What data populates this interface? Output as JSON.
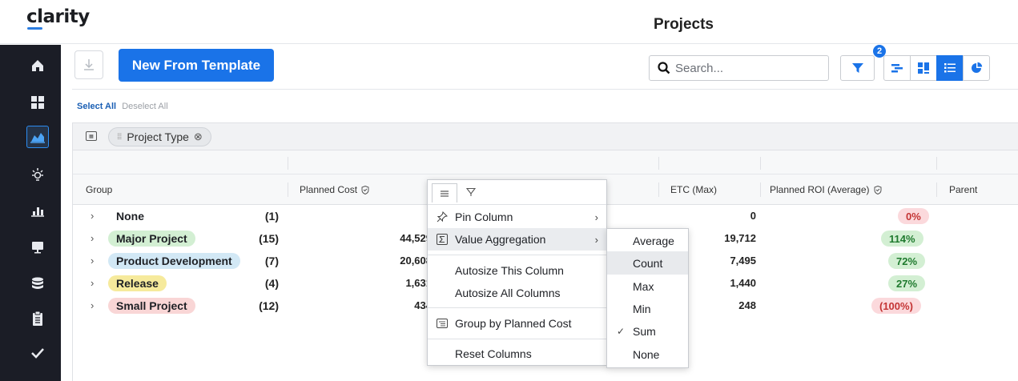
{
  "app": {
    "logo": "clarity",
    "page_title": "Projects"
  },
  "toolbar": {
    "new_template_label": "New From Template",
    "search_placeholder": "Search...",
    "filter_count": "2"
  },
  "selection": {
    "select_all": "Select All",
    "deselect_all": "Deselect All"
  },
  "grouping": {
    "chip_label": "Project Type",
    "remove_symbol": "⊗"
  },
  "columns": {
    "group": "Group",
    "planned_cost": "Planned Cost",
    "etc": "ETC (Max)",
    "planned_roi": "Planned ROI (Average)",
    "parent": "Parent"
  },
  "rows": [
    {
      "label": "None",
      "count": "(1)",
      "cost": "",
      "etc": "0",
      "roi": "0%",
      "tag_color": "",
      "roi_color": "#fbd9dc"
    },
    {
      "label": "Major Project",
      "count": "(15)",
      "cost": "44,529",
      "etc": "19,712",
      "roi": "114%",
      "tag_color": "#d3efd3",
      "roi_color": "#d3efd3"
    },
    {
      "label": "Product Development",
      "count": "(7)",
      "cost": "20,608",
      "etc": "7,495",
      "roi": "72%",
      "tag_color": "#d2e8f5",
      "roi_color": "#d3efd3"
    },
    {
      "label": "Release",
      "count": "(4)",
      "cost": "1,631",
      "etc": "1,440",
      "roi": "27%",
      "tag_color": "#f6ea9c",
      "roi_color": "#d3efd3"
    },
    {
      "label": "Small Project",
      "count": "(12)",
      "cost": "434",
      "etc": "248",
      "roi": "(100%)",
      "tag_color": "#f9d6d6",
      "roi_color": "#fbd9dc"
    }
  ],
  "column_menu": {
    "pin_column": "Pin Column",
    "value_aggregation": "Value Aggregation",
    "autosize_this": "Autosize This Column",
    "autosize_all": "Autosize All Columns",
    "group_by": "Group by Planned Cost",
    "reset_columns": "Reset Columns"
  },
  "aggregation_menu": {
    "items": [
      "Average",
      "Count",
      "Max",
      "Min",
      "Sum",
      "None"
    ],
    "selected": "Sum",
    "highlighted": "Count"
  },
  "nav": {
    "items": [
      "home-icon",
      "dashboard-icon",
      "chart-icon",
      "ideas-icon",
      "bar-chart-icon",
      "presentation-icon",
      "database-icon",
      "clipboard-icon",
      "check-icon"
    ],
    "active": "chart-icon"
  },
  "colors": {
    "accent": "#1a73e8",
    "nav_bg": "#1b1d26"
  }
}
